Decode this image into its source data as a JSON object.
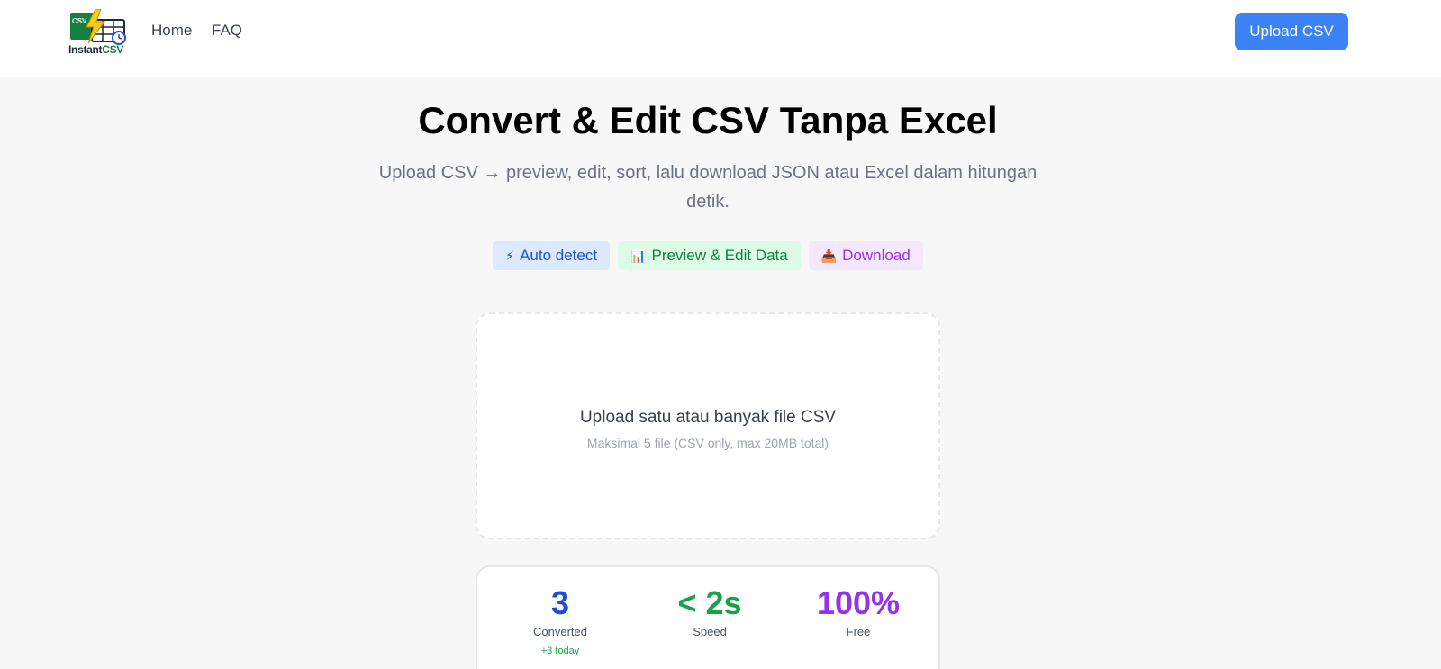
{
  "nav": {
    "logo_badge": "CSV",
    "logo_word_a": "Instant",
    "logo_word_b": "CSV",
    "home": "Home",
    "faq": "FAQ",
    "upload_button": "Upload CSV"
  },
  "hero": {
    "title": "Convert & Edit CSV Tanpa Excel",
    "subtitle": "Upload CSV → preview, edit, sort, lalu download JSON atau Excel dalam hitungan detik."
  },
  "badges": [
    {
      "icon": "⚡",
      "label": "Auto detect",
      "color": "#1d4ed8"
    },
    {
      "icon": "📊",
      "label": "Preview & Edit Data",
      "color": "#15803d"
    },
    {
      "icon": "📥",
      "label": "Download",
      "color": "#9333ea"
    }
  ],
  "dropzone": {
    "title": "Upload satu atau banyak file CSV",
    "subtitle": "Maksimal 5 file (CSV only, max 20MB total)"
  },
  "stats": [
    {
      "value": "3",
      "label": "Converted",
      "extra": "+3 today",
      "color": "#1d4ed8"
    },
    {
      "value": "< 2s",
      "label": "Speed",
      "color": "#16a34a"
    },
    {
      "value": "100%",
      "label": "Free",
      "color": "#9333ea"
    }
  ],
  "colors": {
    "accent": "#3b82f6"
  }
}
